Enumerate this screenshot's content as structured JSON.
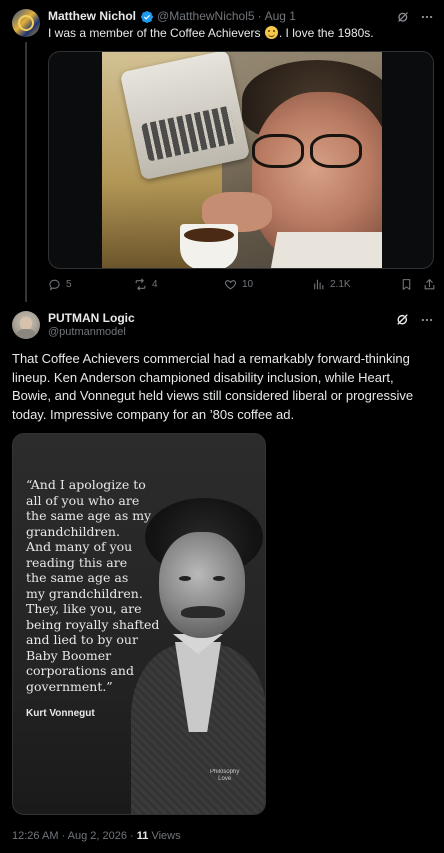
{
  "reply_context": {
    "name": "Matthew Nichol",
    "handle": "@MatthewNichol5",
    "separator": "·",
    "date": "Aug 1",
    "text_before_emoji": "I was a member of the Coffee Achievers ",
    "text_after_emoji": ". I love the 1980s.",
    "emoji": "smiling-face",
    "actions": {
      "replies": "5",
      "reposts": "4",
      "likes": "10",
      "views": "2.1K"
    }
  },
  "tweet": {
    "name": "PUTMAN Logic",
    "handle": "@putmanmodel",
    "text": "That Coffee Achievers commercial had a remarkably forward-thinking lineup. Ken Anderson championed disability inclusion, while Heart, Bowie, and Vonnegut held views still considered liberal or progressive today. Impressive company for an ’80s coffee ad.",
    "image": {
      "quote": "“And I apologize to\nall of you who are\nthe same age as my\ngrandchildren.\nAnd many of you\nreading this are\nthe same age as\nmy grandchildren.\nThey, like you, are\nbeing royally shafted\nand lied to by our\nBaby Boomer\ncorporations and\ngovernment.”",
      "author": "Kurt Vonnegut",
      "watermark": "Philosophy\nLove"
    },
    "timestamp": "12:26 AM · Aug 2, 2026 · ",
    "views_count": "11",
    "views_label": " Views"
  },
  "colors": {
    "background": "#000000",
    "text_primary": "#e7e9ea",
    "text_secondary": "#71767b",
    "verified_blue": "#1d9bf0",
    "divider": "#2f3336"
  }
}
